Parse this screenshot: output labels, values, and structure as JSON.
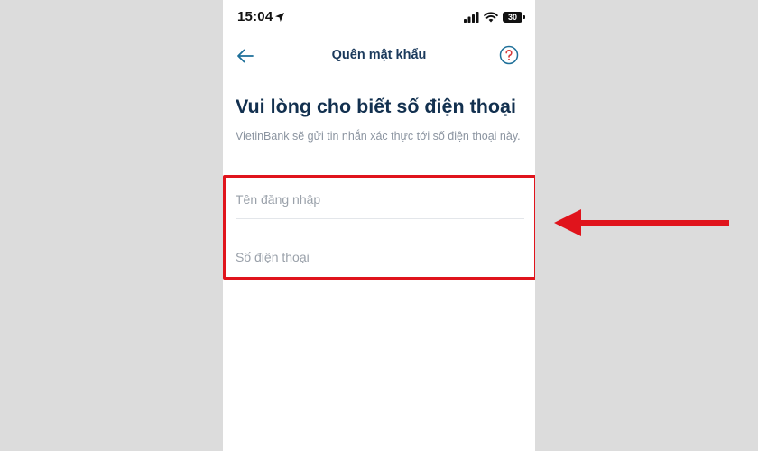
{
  "status_bar": {
    "time": "15:04",
    "battery_level": "30"
  },
  "nav": {
    "title": "Quên mật khẩu"
  },
  "content": {
    "heading": "Vui lòng cho biết số điện thoại",
    "subtext": "VietinBank sẽ gửi tin nhắn xác thực tới số điện thoại này."
  },
  "form": {
    "username_placeholder": "Tên đăng nhập",
    "phone_placeholder": "Số điện thoại"
  },
  "colors": {
    "highlight_red": "#e0141c",
    "navy_text": "#12304f",
    "accent_teal": "#1d6f99",
    "help_icon_red": "#d63b3b"
  },
  "icons": {
    "location": "location-arrow-icon",
    "back": "arrow-left-icon",
    "help": "question-circle-icon"
  }
}
